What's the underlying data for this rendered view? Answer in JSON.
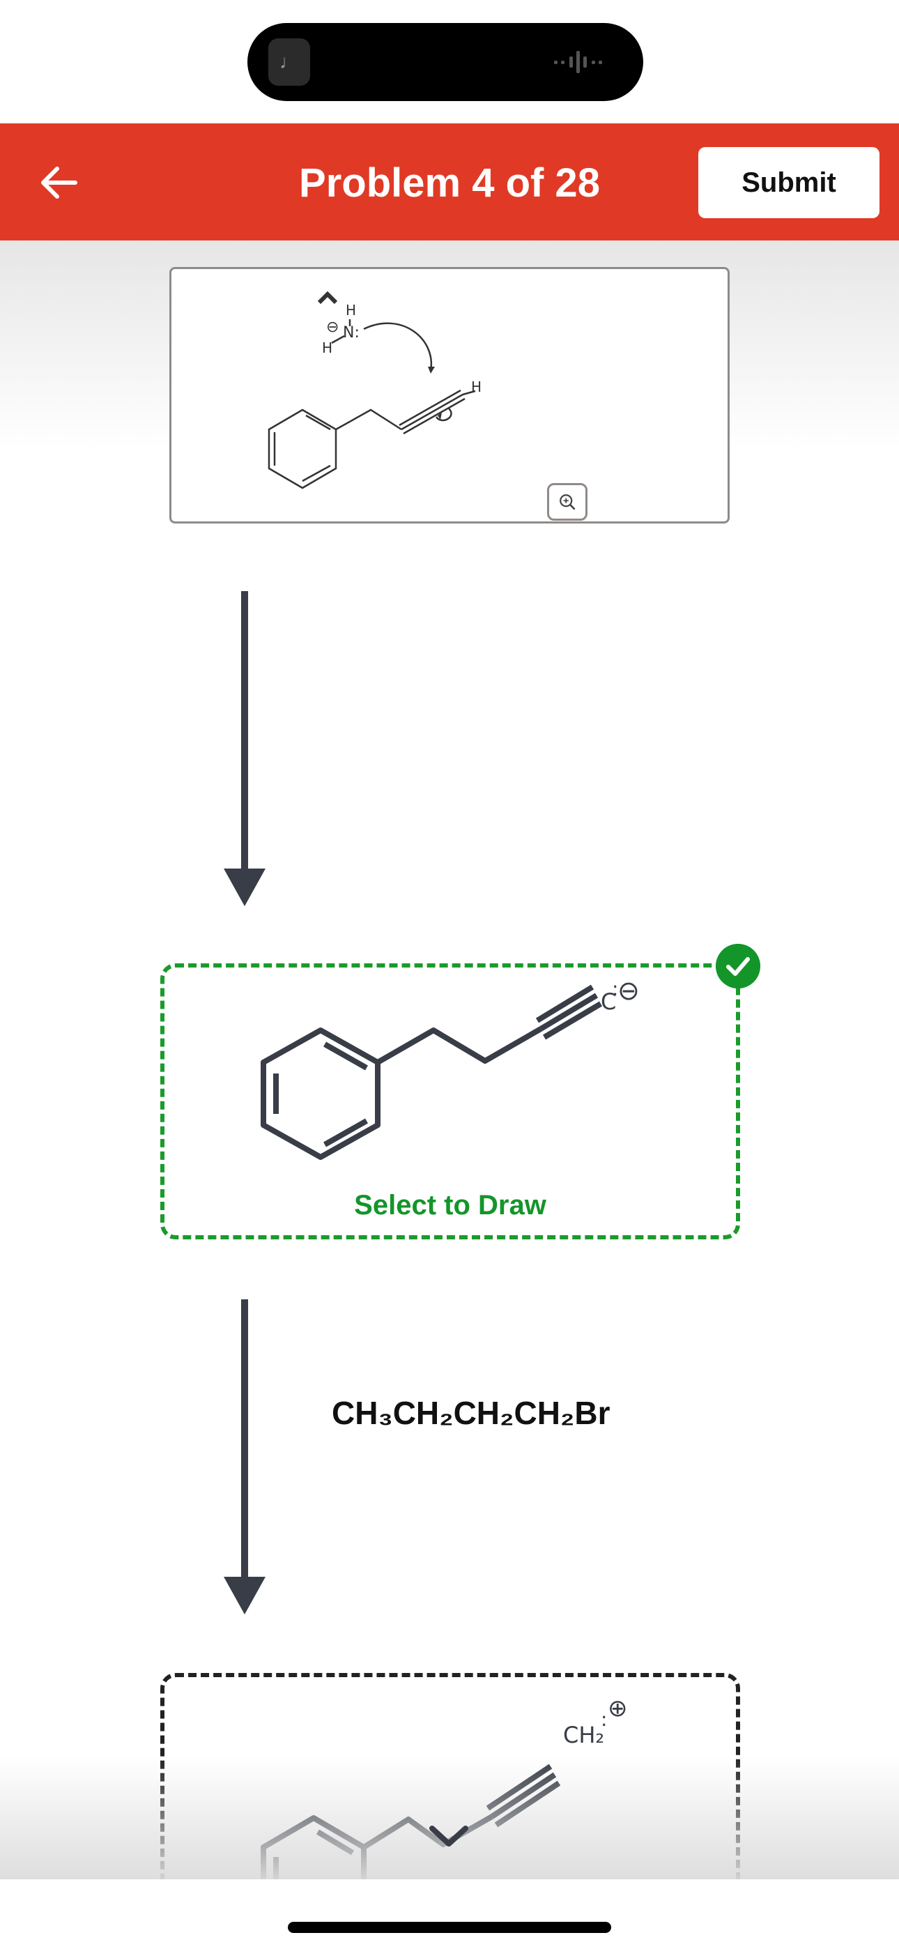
{
  "status_bar": {
    "app_icon": "music-note-icon",
    "activity_icon": "waveform-icon"
  },
  "header": {
    "title": "Problem 4 of 28",
    "submit_label": "Submit",
    "back_icon": "arrow-left-icon",
    "bg_color": "#e03a26"
  },
  "mechanism": {
    "amine_label": "N:",
    "h_top": "H",
    "h_left": "H",
    "charge": "⊖",
    "alkyne_h": "H",
    "zoom_icon": "zoom-in-icon",
    "collapse_icon": "chevron-up-icon"
  },
  "step1": {
    "carbanion_label": "C",
    "charge": "⊖",
    "select_label": "Select to Draw",
    "status_icon": "checkmark-icon",
    "accent": "#14952a"
  },
  "reagent": {
    "formula": "CH₃CH₂CH₂CH₂Br"
  },
  "step2": {
    "group_label": "CH₂",
    "charge": "⊕",
    "expand_icon": "chevron-down-icon"
  }
}
